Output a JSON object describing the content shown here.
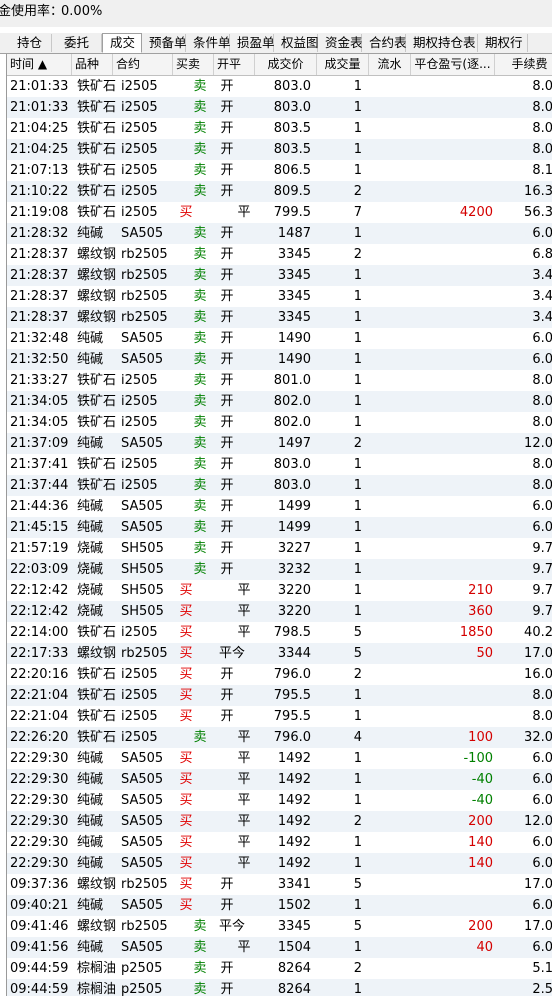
{
  "topbar": {
    "label": "金使用率：",
    "value": "0.00%"
  },
  "tabs": [
    "持仓",
    "委托",
    "成交",
    "预备单",
    "条件单",
    "损盈单",
    "权益图",
    "资金表",
    "合约表",
    "期权持仓表",
    "期权行"
  ],
  "active_tab": "成交",
  "columns": [
    "时间 ▲",
    "品种",
    "合约",
    "买卖",
    "开平",
    "成交价",
    "成交量",
    "流水",
    "平仓盈亏(逐...",
    "手续费"
  ],
  "rows": [
    {
      "time": "21:01:33",
      "variety": "铁矿石",
      "contract": "i2505",
      "side": "卖",
      "oc": "开",
      "price": "803.0",
      "qty": "1",
      "flow": "",
      "pnl": "",
      "fee": "8.0"
    },
    {
      "time": "21:01:33",
      "variety": "铁矿石",
      "contract": "i2505",
      "side": "卖",
      "oc": "开",
      "price": "803.0",
      "qty": "1",
      "flow": "",
      "pnl": "",
      "fee": "8.0"
    },
    {
      "time": "21:04:25",
      "variety": "铁矿石",
      "contract": "i2505",
      "side": "卖",
      "oc": "开",
      "price": "803.5",
      "qty": "1",
      "flow": "",
      "pnl": "",
      "fee": "8.0"
    },
    {
      "time": "21:04:25",
      "variety": "铁矿石",
      "contract": "i2505",
      "side": "卖",
      "oc": "开",
      "price": "803.5",
      "qty": "1",
      "flow": "",
      "pnl": "",
      "fee": "8.0"
    },
    {
      "time": "21:07:13",
      "variety": "铁矿石",
      "contract": "i2505",
      "side": "卖",
      "oc": "开",
      "price": "806.5",
      "qty": "1",
      "flow": "",
      "pnl": "",
      "fee": "8.1"
    },
    {
      "time": "21:10:22",
      "variety": "铁矿石",
      "contract": "i2505",
      "side": "卖",
      "oc": "开",
      "price": "809.5",
      "qty": "2",
      "flow": "",
      "pnl": "",
      "fee": "16.3"
    },
    {
      "time": "21:19:08",
      "variety": "铁矿石",
      "contract": "i2505",
      "side": "买",
      "oc": "平",
      "price": "799.5",
      "qty": "7",
      "flow": "",
      "pnl": "4200",
      "fee": "56.3"
    },
    {
      "time": "21:28:32",
      "variety": "纯碱",
      "contract": "SA505",
      "side": "卖",
      "oc": "开",
      "price": "1487",
      "qty": "1",
      "flow": "",
      "pnl": "",
      "fee": "6.0"
    },
    {
      "time": "21:28:37",
      "variety": "螺纹钢",
      "contract": "rb2505",
      "side": "卖",
      "oc": "开",
      "price": "3345",
      "qty": "2",
      "flow": "",
      "pnl": "",
      "fee": "6.8"
    },
    {
      "time": "21:28:37",
      "variety": "螺纹钢",
      "contract": "rb2505",
      "side": "卖",
      "oc": "开",
      "price": "3345",
      "qty": "1",
      "flow": "",
      "pnl": "",
      "fee": "3.4"
    },
    {
      "time": "21:28:37",
      "variety": "螺纹钢",
      "contract": "rb2505",
      "side": "卖",
      "oc": "开",
      "price": "3345",
      "qty": "1",
      "flow": "",
      "pnl": "",
      "fee": "3.4"
    },
    {
      "time": "21:28:37",
      "variety": "螺纹钢",
      "contract": "rb2505",
      "side": "卖",
      "oc": "开",
      "price": "3345",
      "qty": "1",
      "flow": "",
      "pnl": "",
      "fee": "3.4"
    },
    {
      "time": "21:32:48",
      "variety": "纯碱",
      "contract": "SA505",
      "side": "卖",
      "oc": "开",
      "price": "1490",
      "qty": "1",
      "flow": "",
      "pnl": "",
      "fee": "6.0"
    },
    {
      "time": "21:32:50",
      "variety": "纯碱",
      "contract": "SA505",
      "side": "卖",
      "oc": "开",
      "price": "1490",
      "qty": "1",
      "flow": "",
      "pnl": "",
      "fee": "6.0"
    },
    {
      "time": "21:33:27",
      "variety": "铁矿石",
      "contract": "i2505",
      "side": "卖",
      "oc": "开",
      "price": "801.0",
      "qty": "1",
      "flow": "",
      "pnl": "",
      "fee": "8.0"
    },
    {
      "time": "21:34:05",
      "variety": "铁矿石",
      "contract": "i2505",
      "side": "卖",
      "oc": "开",
      "price": "802.0",
      "qty": "1",
      "flow": "",
      "pnl": "",
      "fee": "8.0"
    },
    {
      "time": "21:34:05",
      "variety": "铁矿石",
      "contract": "i2505",
      "side": "卖",
      "oc": "开",
      "price": "802.0",
      "qty": "1",
      "flow": "",
      "pnl": "",
      "fee": "8.0"
    },
    {
      "time": "21:37:09",
      "variety": "纯碱",
      "contract": "SA505",
      "side": "卖",
      "oc": "开",
      "price": "1497",
      "qty": "2",
      "flow": "",
      "pnl": "",
      "fee": "12.0"
    },
    {
      "time": "21:37:41",
      "variety": "铁矿石",
      "contract": "i2505",
      "side": "卖",
      "oc": "开",
      "price": "803.0",
      "qty": "1",
      "flow": "",
      "pnl": "",
      "fee": "8.0"
    },
    {
      "time": "21:37:44",
      "variety": "铁矿石",
      "contract": "i2505",
      "side": "卖",
      "oc": "开",
      "price": "803.0",
      "qty": "1",
      "flow": "",
      "pnl": "",
      "fee": "8.0"
    },
    {
      "time": "21:44:36",
      "variety": "纯碱",
      "contract": "SA505",
      "side": "卖",
      "oc": "开",
      "price": "1499",
      "qty": "1",
      "flow": "",
      "pnl": "",
      "fee": "6.0"
    },
    {
      "time": "21:45:15",
      "variety": "纯碱",
      "contract": "SA505",
      "side": "卖",
      "oc": "开",
      "price": "1499",
      "qty": "1",
      "flow": "",
      "pnl": "",
      "fee": "6.0"
    },
    {
      "time": "21:57:19",
      "variety": "烧碱",
      "contract": "SH505",
      "side": "卖",
      "oc": "开",
      "price": "3227",
      "qty": "1",
      "flow": "",
      "pnl": "",
      "fee": "9.7"
    },
    {
      "time": "22:03:09",
      "variety": "烧碱",
      "contract": "SH505",
      "side": "卖",
      "oc": "开",
      "price": "3232",
      "qty": "1",
      "flow": "",
      "pnl": "",
      "fee": "9.7"
    },
    {
      "time": "22:12:42",
      "variety": "烧碱",
      "contract": "SH505",
      "side": "买",
      "oc": "平",
      "price": "3220",
      "qty": "1",
      "flow": "",
      "pnl": "210",
      "fee": "9.7"
    },
    {
      "time": "22:12:42",
      "variety": "烧碱",
      "contract": "SH505",
      "side": "买",
      "oc": "平",
      "price": "3220",
      "qty": "1",
      "flow": "",
      "pnl": "360",
      "fee": "9.7"
    },
    {
      "time": "22:14:00",
      "variety": "铁矿石",
      "contract": "i2505",
      "side": "买",
      "oc": "平",
      "price": "798.5",
      "qty": "5",
      "flow": "",
      "pnl": "1850",
      "fee": "40.2"
    },
    {
      "time": "22:17:33",
      "variety": "螺纹钢",
      "contract": "rb2505",
      "side": "买",
      "oc": "平今",
      "price": "3344",
      "qty": "5",
      "flow": "",
      "pnl": "50",
      "fee": "17.0"
    },
    {
      "time": "22:20:16",
      "variety": "铁矿石",
      "contract": "i2505",
      "side": "买",
      "oc": "开",
      "price": "796.0",
      "qty": "2",
      "flow": "",
      "pnl": "",
      "fee": "16.0"
    },
    {
      "time": "22:21:04",
      "variety": "铁矿石",
      "contract": "i2505",
      "side": "买",
      "oc": "开",
      "price": "795.5",
      "qty": "1",
      "flow": "",
      "pnl": "",
      "fee": "8.0"
    },
    {
      "time": "22:21:04",
      "variety": "铁矿石",
      "contract": "i2505",
      "side": "买",
      "oc": "开",
      "price": "795.5",
      "qty": "1",
      "flow": "",
      "pnl": "",
      "fee": "8.0"
    },
    {
      "time": "22:26:20",
      "variety": "铁矿石",
      "contract": "i2505",
      "side": "卖",
      "oc": "平",
      "price": "796.0",
      "qty": "4",
      "flow": "",
      "pnl": "100",
      "fee": "32.0"
    },
    {
      "time": "22:29:30",
      "variety": "纯碱",
      "contract": "SA505",
      "side": "买",
      "oc": "平",
      "price": "1492",
      "qty": "1",
      "flow": "",
      "pnl": "-100",
      "fee": "6.0"
    },
    {
      "time": "22:29:30",
      "variety": "纯碱",
      "contract": "SA505",
      "side": "买",
      "oc": "平",
      "price": "1492",
      "qty": "1",
      "flow": "",
      "pnl": "-40",
      "fee": "6.0"
    },
    {
      "time": "22:29:30",
      "variety": "纯碱",
      "contract": "SA505",
      "side": "买",
      "oc": "平",
      "price": "1492",
      "qty": "1",
      "flow": "",
      "pnl": "-40",
      "fee": "6.0"
    },
    {
      "time": "22:29:30",
      "variety": "纯碱",
      "contract": "SA505",
      "side": "买",
      "oc": "平",
      "price": "1492",
      "qty": "2",
      "flow": "",
      "pnl": "200",
      "fee": "12.0"
    },
    {
      "time": "22:29:30",
      "variety": "纯碱",
      "contract": "SA505",
      "side": "买",
      "oc": "平",
      "price": "1492",
      "qty": "1",
      "flow": "",
      "pnl": "140",
      "fee": "6.0"
    },
    {
      "time": "22:29:30",
      "variety": "纯碱",
      "contract": "SA505",
      "side": "买",
      "oc": "平",
      "price": "1492",
      "qty": "1",
      "flow": "",
      "pnl": "140",
      "fee": "6.0"
    },
    {
      "time": "09:37:36",
      "variety": "螺纹钢",
      "contract": "rb2505",
      "side": "买",
      "oc": "开",
      "price": "3341",
      "qty": "5",
      "flow": "",
      "pnl": "",
      "fee": "17.0"
    },
    {
      "time": "09:40:21",
      "variety": "纯碱",
      "contract": "SA505",
      "side": "买",
      "oc": "开",
      "price": "1502",
      "qty": "1",
      "flow": "",
      "pnl": "",
      "fee": "6.0"
    },
    {
      "time": "09:41:46",
      "variety": "螺纹钢",
      "contract": "rb2505",
      "side": "卖",
      "oc": "平今",
      "price": "3345",
      "qty": "5",
      "flow": "",
      "pnl": "200",
      "fee": "17.0"
    },
    {
      "time": "09:41:56",
      "variety": "纯碱",
      "contract": "SA505",
      "side": "卖",
      "oc": "平",
      "price": "1504",
      "qty": "1",
      "flow": "",
      "pnl": "40",
      "fee": "6.0"
    },
    {
      "time": "09:44:59",
      "variety": "棕榈油",
      "contract": "p2505",
      "side": "卖",
      "oc": "开",
      "price": "8264",
      "qty": "2",
      "flow": "",
      "pnl": "",
      "fee": "5.1"
    },
    {
      "time": "09:44:59",
      "variety": "棕榈油",
      "contract": "p2505",
      "side": "卖",
      "oc": "开",
      "price": "8264",
      "qty": "1",
      "flow": "",
      "pnl": "",
      "fee": "2.5"
    }
  ],
  "colors": {
    "buy": "#e00000",
    "sell": "#008000",
    "profit": "#d40000",
    "loss": "#008000",
    "row_alt": "#eef3f8"
  }
}
